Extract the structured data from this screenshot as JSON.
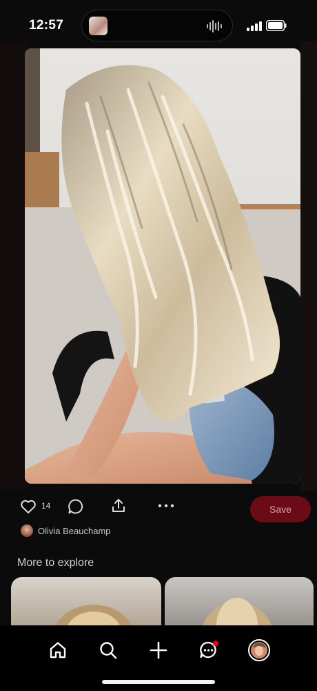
{
  "status_bar": {
    "time": "12:57"
  },
  "pin": {
    "image_description_icon": "pin-photo",
    "like_count": "14",
    "save_label": "Save",
    "author": "Olivia Beauchamp"
  },
  "explore": {
    "title": "More to explore"
  },
  "colors": {
    "save_bg": "#6b0b16",
    "notification_dot": "#e60023"
  },
  "tabs": [
    {
      "name": "home-icon"
    },
    {
      "name": "search-icon"
    },
    {
      "name": "create-icon"
    },
    {
      "name": "messages-icon"
    },
    {
      "name": "profile-avatar"
    }
  ]
}
